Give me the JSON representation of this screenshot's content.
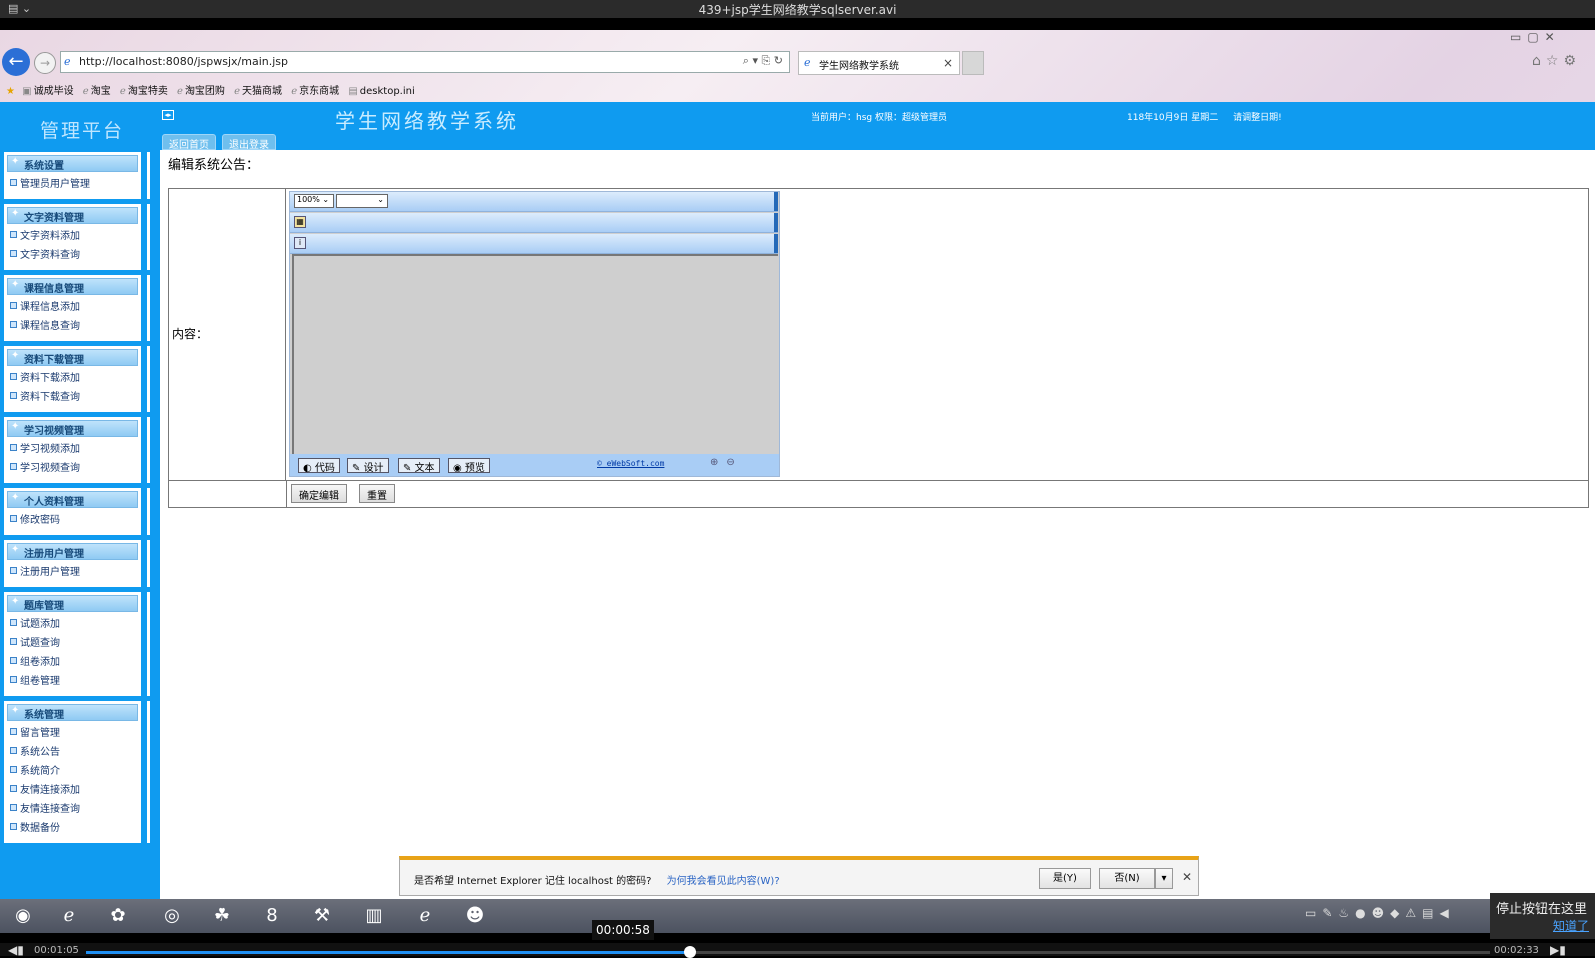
{
  "player": {
    "title": "439+jsp学生网络教学sqlserver.avi",
    "elapsed": "00:01:05",
    "total": "00:02:33",
    "hover_time": "00:00:58",
    "progress": 0.43,
    "tip_text": "停止按钮在这里",
    "tip_ok": "知道了"
  },
  "browser": {
    "url": "http://localhost:8080/jspwsjx/main.jsp",
    "tab_title": "学生网络教学系统",
    "favorites": [
      "诚成毕设",
      "淘宝",
      "淘宝特卖",
      "淘宝团购",
      "天猫商城",
      "京东商城",
      "desktop.ini"
    ]
  },
  "header": {
    "brand": "管理平台",
    "system_title": "学生网络教学系统",
    "tabs": [
      "返回首页",
      "退出登录"
    ],
    "user_info": "当前用户：hsg  权限：超级管理员",
    "date": "118年10月9日 星期二",
    "date_hint": "请调整日期!"
  },
  "sidebar": {
    "groups": [
      {
        "title": "系统设置",
        "items": [
          "管理员用户管理"
        ]
      },
      {
        "title": "文字资料管理",
        "items": [
          "文字资料添加",
          "文字资料查询"
        ]
      },
      {
        "title": "课程信息管理",
        "items": [
          "课程信息添加",
          "课程信息查询"
        ]
      },
      {
        "title": "资料下载管理",
        "items": [
          "资料下载添加",
          "资料下载查询"
        ]
      },
      {
        "title": "学习视频管理",
        "items": [
          "学习视频添加",
          "学习视频查询"
        ]
      },
      {
        "title": "个人资料管理",
        "items": [
          "修改密码"
        ]
      },
      {
        "title": "注册用户管理",
        "items": [
          "注册用户管理"
        ]
      },
      {
        "title": "题库管理",
        "items": [
          "试题添加",
          "试题查询",
          "组卷添加",
          "组卷管理"
        ]
      },
      {
        "title": "系统管理",
        "items": [
          "留言管理",
          "系统公告",
          "系统简介",
          "友情连接添加",
          "友情连接查询",
          "数据备份"
        ]
      }
    ]
  },
  "main": {
    "heading": "编辑系统公告：",
    "content_label": "内容：",
    "editor": {
      "zoom": "100%",
      "modes": [
        "代码",
        "设计",
        "文本",
        "预览"
      ],
      "credit": "© eWebSoft.com"
    },
    "submit_label": "确定编辑",
    "reset_label": "重置"
  },
  "password_prompt": {
    "message": "是否希望 Internet Explorer 记住 localhost 的密码?",
    "link": "为何我会看见此内容(W)?",
    "yes": "是(Y)",
    "no": "否(N)"
  }
}
